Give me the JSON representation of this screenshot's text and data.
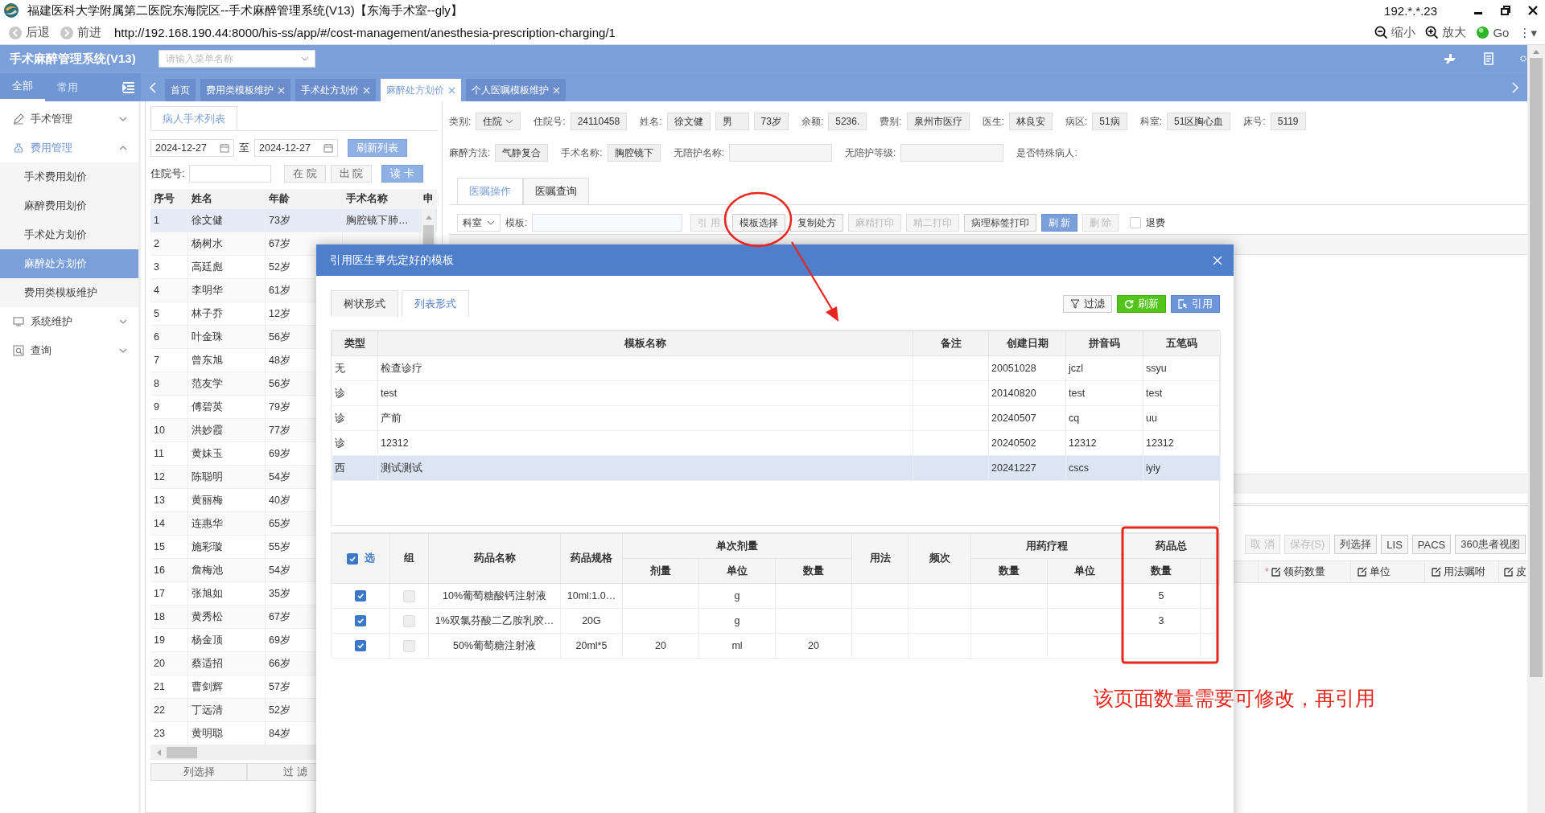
{
  "browser": {
    "title": "福建医科大学附属第二医院东海院区--手术麻醉管理系统(V13)【东海手术室--gly】",
    "ip": "192.*.*.23",
    "back": "后退",
    "forward": "前进",
    "url": "http://192.168.190.44:8000/his-ss/app/#/cost-management/anesthesia-prescription-charging/1",
    "zoom_out": "缩小",
    "zoom_in": "放大",
    "go": "Go",
    "more": "⋮▾"
  },
  "app": {
    "title": "手术麻醉管理系统(V13)",
    "menu_search": {
      "placeholder": "请输入菜单名称"
    }
  },
  "side_tabs": [
    {
      "label": "全部",
      "selected": true
    },
    {
      "label": "常用",
      "selected": false
    }
  ],
  "page_tabs": [
    {
      "label": "首页",
      "closable": false,
      "selected": false
    },
    {
      "label": "费用类模板维护",
      "closable": true,
      "selected": false
    },
    {
      "label": "手术处方划价",
      "closable": true,
      "selected": false
    },
    {
      "label": "麻醉处方划价",
      "closable": true,
      "selected": true
    },
    {
      "label": "个人医嘱模板维护",
      "closable": true,
      "selected": false
    }
  ],
  "sidebar": {
    "items": [
      {
        "label": "手术管理",
        "expanded": false
      },
      {
        "label": "费用管理",
        "expanded": true,
        "children": [
          {
            "label": "手术费用划价",
            "selected": false
          },
          {
            "label": "麻醉费用划价",
            "selected": false
          },
          {
            "label": "手术处方划价",
            "selected": false
          },
          {
            "label": "麻醉处方划价",
            "selected": true
          },
          {
            "label": "费用类模板维护",
            "selected": false
          }
        ]
      },
      {
        "label": "系统维护",
        "expanded": false
      },
      {
        "label": "查询",
        "expanded": false
      }
    ]
  },
  "patient_list": {
    "tab": "病人手术列表",
    "date_from": "2024-12-27",
    "to": "至",
    "date_to": "2024-12-27",
    "refresh": "刷新列表",
    "admission_label": "住院号:",
    "buttons": [
      {
        "label": "在 院",
        "primary": false
      },
      {
        "label": "出 院",
        "primary": false
      },
      {
        "label": "读 卡",
        "primary": true
      }
    ],
    "columns": [
      "序号",
      "姓名",
      "年龄",
      "手术名称",
      "申"
    ],
    "rows": [
      {
        "no": "1",
        "name": "徐文健",
        "age": "73岁",
        "surgery": "胸腔镜下肺…",
        "selected": true
      },
      {
        "no": "2",
        "name": "杨树水",
        "age": "67岁",
        "selected": false
      },
      {
        "no": "3",
        "name": "高廷彪",
        "age": "52岁",
        "selected": false
      },
      {
        "no": "4",
        "name": "李明华",
        "age": "61岁",
        "selected": false
      },
      {
        "no": "5",
        "name": "林子乔",
        "age": "12岁",
        "selected": false
      },
      {
        "no": "6",
        "name": "叶金珠",
        "age": "56岁",
        "selected": false
      },
      {
        "no": "7",
        "name": "曾东旭",
        "age": "48岁",
        "selected": false
      },
      {
        "no": "8",
        "name": "范友学",
        "age": "56岁",
        "selected": false
      },
      {
        "no": "9",
        "name": "傅碧英",
        "age": "79岁",
        "selected": false
      },
      {
        "no": "10",
        "name": "洪妙霞",
        "age": "77岁",
        "selected": false
      },
      {
        "no": "11",
        "name": "黄妹玉",
        "age": "69岁",
        "selected": false
      },
      {
        "no": "12",
        "name": "陈聪明",
        "age": "54岁",
        "selected": false
      },
      {
        "no": "13",
        "name": "黄丽梅",
        "age": "40岁",
        "selected": false
      },
      {
        "no": "14",
        "name": "连惠华",
        "age": "65岁",
        "selected": false
      },
      {
        "no": "15",
        "name": "施彩璇",
        "age": "55岁",
        "selected": false
      },
      {
        "no": "16",
        "name": "詹梅池",
        "age": "54岁",
        "selected": false
      },
      {
        "no": "17",
        "name": "张旭如",
        "age": "35岁",
        "selected": false
      },
      {
        "no": "18",
        "name": "黄秀松",
        "age": "67岁",
        "selected": false
      },
      {
        "no": "19",
        "name": "杨金顶",
        "age": "69岁",
        "selected": false
      },
      {
        "no": "20",
        "name": "蔡适招",
        "age": "66岁",
        "selected": false
      },
      {
        "no": "21",
        "name": "曹剑辉",
        "age": "57岁",
        "selected": false
      },
      {
        "no": "22",
        "name": "丁远清",
        "age": "52岁",
        "selected": false
      },
      {
        "no": "23",
        "name": "黄明聪",
        "age": "84岁",
        "selected": false
      }
    ],
    "footer": [
      "列选择",
      "过 滤"
    ]
  },
  "patient_info": [
    [
      {
        "label": "类别:",
        "kind": "select",
        "values": [
          "住院"
        ]
      },
      {
        "label": "住院号:",
        "kind": "text",
        "values": [
          "24110458"
        ]
      },
      {
        "label": "姓名:",
        "kind": "text",
        "values": [
          "徐文健",
          "男",
          "73岁"
        ]
      },
      {
        "label": "余额:",
        "kind": "text",
        "values": [
          "5236."
        ]
      },
      {
        "label": "费别:",
        "kind": "text",
        "values": [
          "泉州市医疗"
        ]
      },
      {
        "label": "医生:",
        "kind": "text",
        "values": [
          "林良安"
        ]
      },
      {
        "label": "病区:",
        "kind": "text",
        "values": [
          "51病"
        ]
      },
      {
        "label": "科室:",
        "kind": "text",
        "values": [
          "51区胸心血"
        ]
      },
      {
        "label": "床号:",
        "kind": "text",
        "values": [
          "5119"
        ]
      }
    ],
    [
      {
        "label": "麻醉方法:",
        "kind": "text",
        "values": [
          "气静复合"
        ]
      },
      {
        "label": "手术名称:",
        "kind": "text",
        "values": [
          "胸腔镜下"
        ]
      },
      {
        "label": "无陪护名称:",
        "kind": "empty"
      },
      {
        "label": "无陪护等级:",
        "kind": "empty"
      },
      {
        "label": "是否特殊病人:",
        "kind": "none"
      }
    ]
  ],
  "order_tabs": [
    {
      "label": "医嘱操作",
      "selected": true
    },
    {
      "label": "医嘱查询",
      "selected": false
    }
  ],
  "order_toolbar": {
    "dept": "科室",
    "template_label": "模板:",
    "buttons": [
      {
        "label": "引 用",
        "primary": false,
        "disabled": true
      },
      {
        "label": "模板选择",
        "primary": false,
        "disabled": false
      },
      {
        "label": "复制处方",
        "primary": false,
        "disabled": false
      },
      {
        "label": "麻精打印",
        "primary": false,
        "disabled": true
      },
      {
        "label": "精二打印",
        "primary": false,
        "disabled": true
      },
      {
        "label": "病理标签打印",
        "primary": false,
        "disabled": false
      },
      {
        "label": "刷 新",
        "primary": true,
        "disabled": false
      },
      {
        "label": "删 除",
        "primary": false,
        "disabled": true
      }
    ],
    "refund": {
      "label": "退费",
      "checked": false
    }
  },
  "lower_toolbar": [
    {
      "label": "取 消",
      "disabled": true
    },
    {
      "label": "保存(S)",
      "disabled": true
    },
    {
      "label": "列选择",
      "disabled": false
    },
    {
      "label": "LIS",
      "disabled": false
    },
    {
      "label": "PACS",
      "disabled": false
    },
    {
      "label": "360患者视图",
      "disabled": false
    }
  ],
  "lower_columns": [
    {
      "mark": "*",
      "label": "领药数量"
    },
    {
      "label": "单位"
    },
    {
      "label": "用法嘱咐"
    },
    {
      "label": "皮"
    }
  ],
  "modal": {
    "title": "引用医生事先定好的模板",
    "tabs": [
      {
        "label": "树状形式",
        "selected": false
      },
      {
        "label": "列表形式",
        "selected": true
      }
    ],
    "actions": [
      {
        "label": "过滤",
        "kind": "filter"
      },
      {
        "label": "刷新",
        "kind": "refresh"
      },
      {
        "label": "引用",
        "kind": "quote"
      }
    ],
    "template_columns": [
      "类型",
      "模板名称",
      "备注",
      "创建日期",
      "拼音码",
      "五笔码"
    ],
    "templates": [
      {
        "type": "无",
        "name": "检查诊疗",
        "created": "20051028",
        "pinyin": "jczl",
        "wubi": "ssyu",
        "selected": false
      },
      {
        "type": "诊",
        "name": "test",
        "created": "20140820",
        "pinyin": "test",
        "wubi": "test",
        "selected": false
      },
      {
        "type": "诊",
        "name": "产前",
        "created": "20240507",
        "pinyin": "cq",
        "wubi": "uu",
        "selected": false
      },
      {
        "type": "诊",
        "name": "12312",
        "created": "20240502",
        "pinyin": "12312",
        "wubi": "12312",
        "selected": false
      },
      {
        "type": "西",
        "name": "测试测试",
        "created": "20241227",
        "pinyin": "cscs",
        "wubi": "iyiy",
        "selected": true
      }
    ],
    "drug_header": [
      {
        "label": "选",
        "kind": "check",
        "checked": true
      },
      {
        "label": "组"
      },
      {
        "label": "药品名称"
      },
      {
        "label": "药品规格"
      },
      {
        "label": "单次剂量",
        "sub": [
          "剂量",
          "单位",
          "数量"
        ]
      },
      {
        "label": "用法"
      },
      {
        "label": "频次"
      },
      {
        "label": "用药疗程",
        "sub": [
          "数量",
          "单位"
        ]
      },
      {
        "label": "药品总",
        "sub": [
          "数量"
        ]
      }
    ],
    "drugs": [
      {
        "checked": true,
        "grouped": false,
        "name": "10%葡萄糖酸钙注射液",
        "spec": "10ml:1.0…",
        "unit": "g",
        "total": "5"
      },
      {
        "checked": true,
        "grouped": false,
        "name": "1%双氯芬酸二乙胺乳胶…",
        "spec": "20G",
        "unit": "g",
        "total": "3"
      },
      {
        "checked": true,
        "grouped": false,
        "name": "50%葡萄糖注射液",
        "spec": "20ml*5",
        "dose": "20",
        "unit": "ml",
        "qty": "20"
      }
    ]
  },
  "annotation": {
    "note": "该页面数量需要可修改，再引用"
  }
}
